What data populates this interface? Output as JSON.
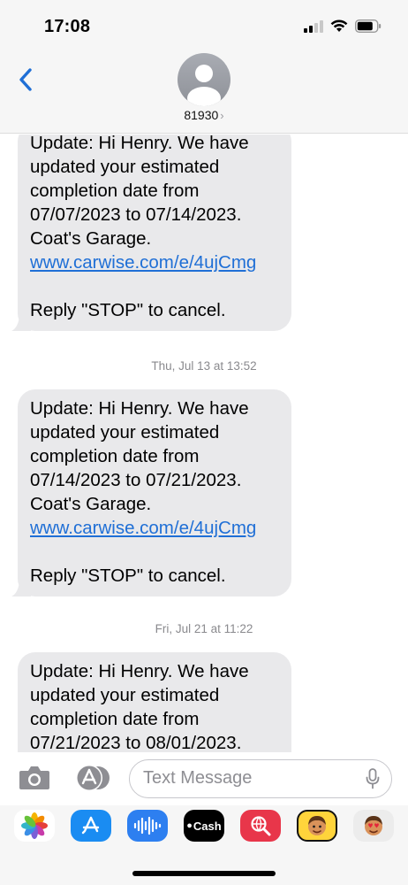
{
  "status_bar": {
    "time": "17:08"
  },
  "header": {
    "contact_name": "81930",
    "chevron": "›"
  },
  "messages": [
    {
      "lines": [
        "Update: Hi Henry. We have",
        "updated your estimated",
        "completion date from",
        "07/07/2023 to 07/14/2023.",
        "Coat's Garage."
      ],
      "link": "www.carwise.com/e/4ujCmg",
      "footer": "Reply \"STOP\" to cancel."
    },
    {
      "timestamp": "Thu, Jul 13 at 13:52",
      "lines": [
        "Update: Hi Henry. We have",
        "updated your estimated",
        "completion date from",
        "07/14/2023 to 07/21/2023.",
        "Coat's Garage."
      ],
      "link": "www.carwise.com/e/4ujCmg",
      "footer": "Reply \"STOP\" to cancel."
    },
    {
      "timestamp": "Fri, Jul 21 at 11:22",
      "lines": [
        "Update: Hi Henry. We have",
        "updated your estimated",
        "completion date from",
        "07/21/2023 to 08/01/2023."
      ]
    }
  ],
  "input": {
    "placeholder": "Text Message"
  },
  "app_drawer": {
    "icons": [
      "photos-icon",
      "app-store-icon",
      "audio-message-icon",
      "apple-cash-icon",
      "web-images-icon",
      "memoji-icon",
      "memoji-stickers-icon"
    ],
    "cash_label": "Cash"
  },
  "colors": {
    "bubble": "#e9e9eb",
    "link": "#1f6fd6",
    "back": "#1f6fd6",
    "timestamp": "#8a8a8e"
  }
}
